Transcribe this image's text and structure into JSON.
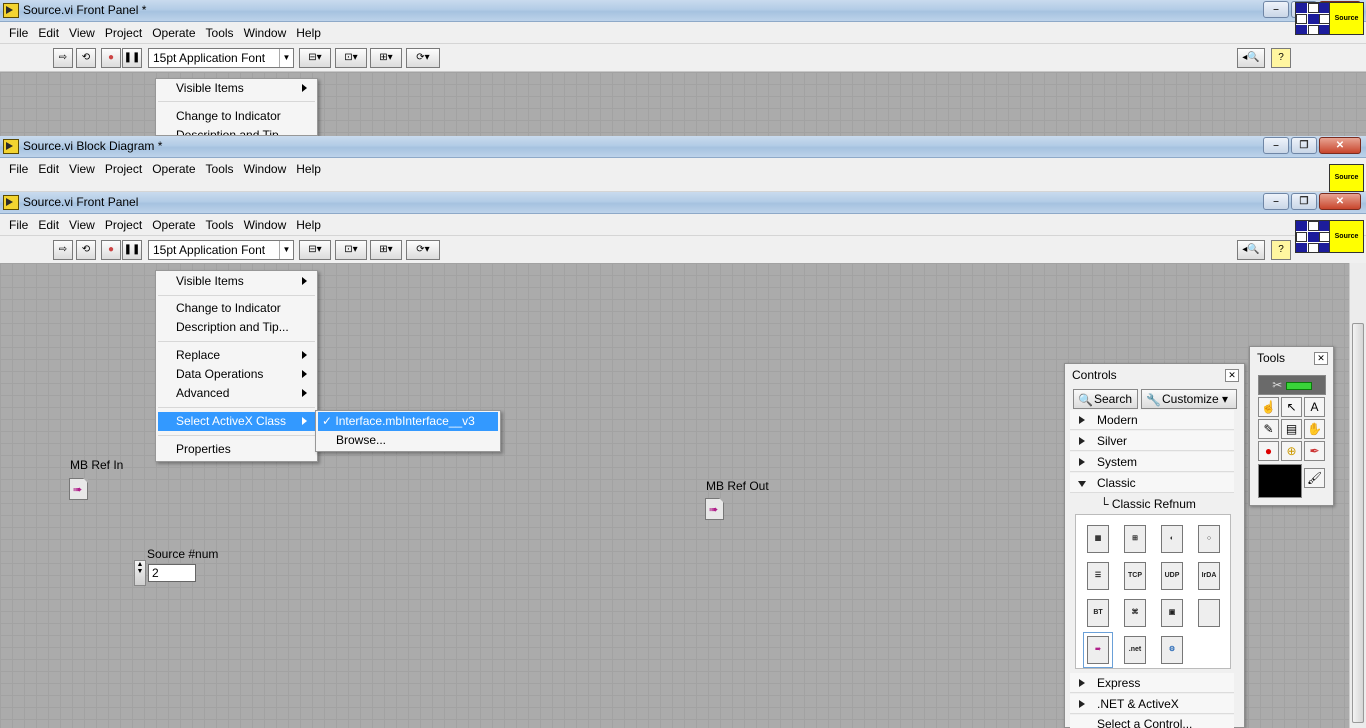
{
  "windows": [
    {
      "title": "Source.vi Front Panel *"
    },
    {
      "title": "Source.vi Block Diagram *"
    },
    {
      "title": "Source.vi Front Panel"
    }
  ],
  "menubar": [
    "File",
    "Edit",
    "View",
    "Project",
    "Operate",
    "Tools",
    "Window",
    "Help"
  ],
  "toolbar": {
    "font": "15pt Application Font"
  },
  "source_icon_label": "Source",
  "context_menu": {
    "items": [
      {
        "label": "Visible Items",
        "submenu": true
      },
      {
        "label": "Change to Indicator",
        "submenu": false
      },
      {
        "label": "Description and Tip...",
        "submenu": false
      },
      {
        "label": "Replace",
        "submenu": true
      },
      {
        "label": "Data Operations",
        "submenu": true
      },
      {
        "label": "Advanced",
        "submenu": true
      },
      {
        "label": "Select ActiveX Class",
        "submenu": true,
        "highlighted": true
      },
      {
        "label": "Properties",
        "submenu": false
      }
    ],
    "bg_items": {
      "visible": "Visible Items",
      "change": "Change to Indicator",
      "desc": "Description and Tip"
    }
  },
  "submenu": {
    "items": [
      {
        "label": "✓ Interface.mbInterface__v3",
        "highlighted": true
      },
      {
        "label": "Browse..."
      }
    ]
  },
  "front_panel": {
    "mb_ref_in": "MB Ref In",
    "mb_ref_out": "MB Ref Out",
    "source_num_label": "Source #num",
    "source_num_value": "2"
  },
  "controls_palette": {
    "title": "Controls",
    "search": "Search",
    "customize": "Customize",
    "categories": [
      "Modern",
      "Silver",
      "System",
      "Classic"
    ],
    "subcategory": "Classic Refnum",
    "bottom_categories": [
      "Express",
      ".NET & ActiveX",
      "Select a Control..."
    ],
    "icon_labels": [
      "TCP",
      "UDP",
      "IrDA",
      "BT",
      ".net"
    ]
  },
  "tools_palette": {
    "title": "Tools"
  },
  "colors": {
    "highlight": "#3399ff",
    "source_icon": "#ffff00"
  }
}
